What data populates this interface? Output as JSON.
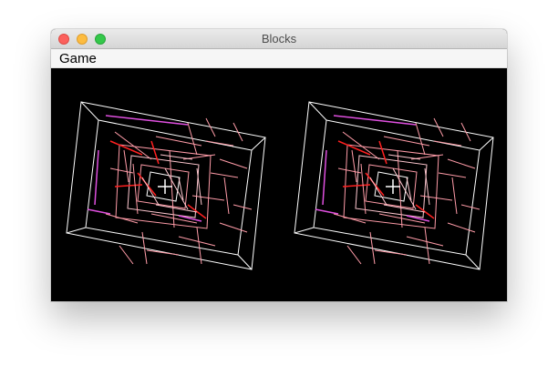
{
  "window": {
    "title": "Blocks"
  },
  "menubar": {
    "items": [
      {
        "label": "Game"
      }
    ]
  },
  "canvas": {
    "background": "#000000",
    "views": [
      {
        "name": "left-eye-view"
      },
      {
        "name": "right-eye-view"
      }
    ],
    "colors": {
      "frame": "#ffffff",
      "pink": "#ff9ca8",
      "magenta": "#e050e0",
      "red": "#ff2020",
      "light_pink": "#ffc8d0"
    }
  }
}
